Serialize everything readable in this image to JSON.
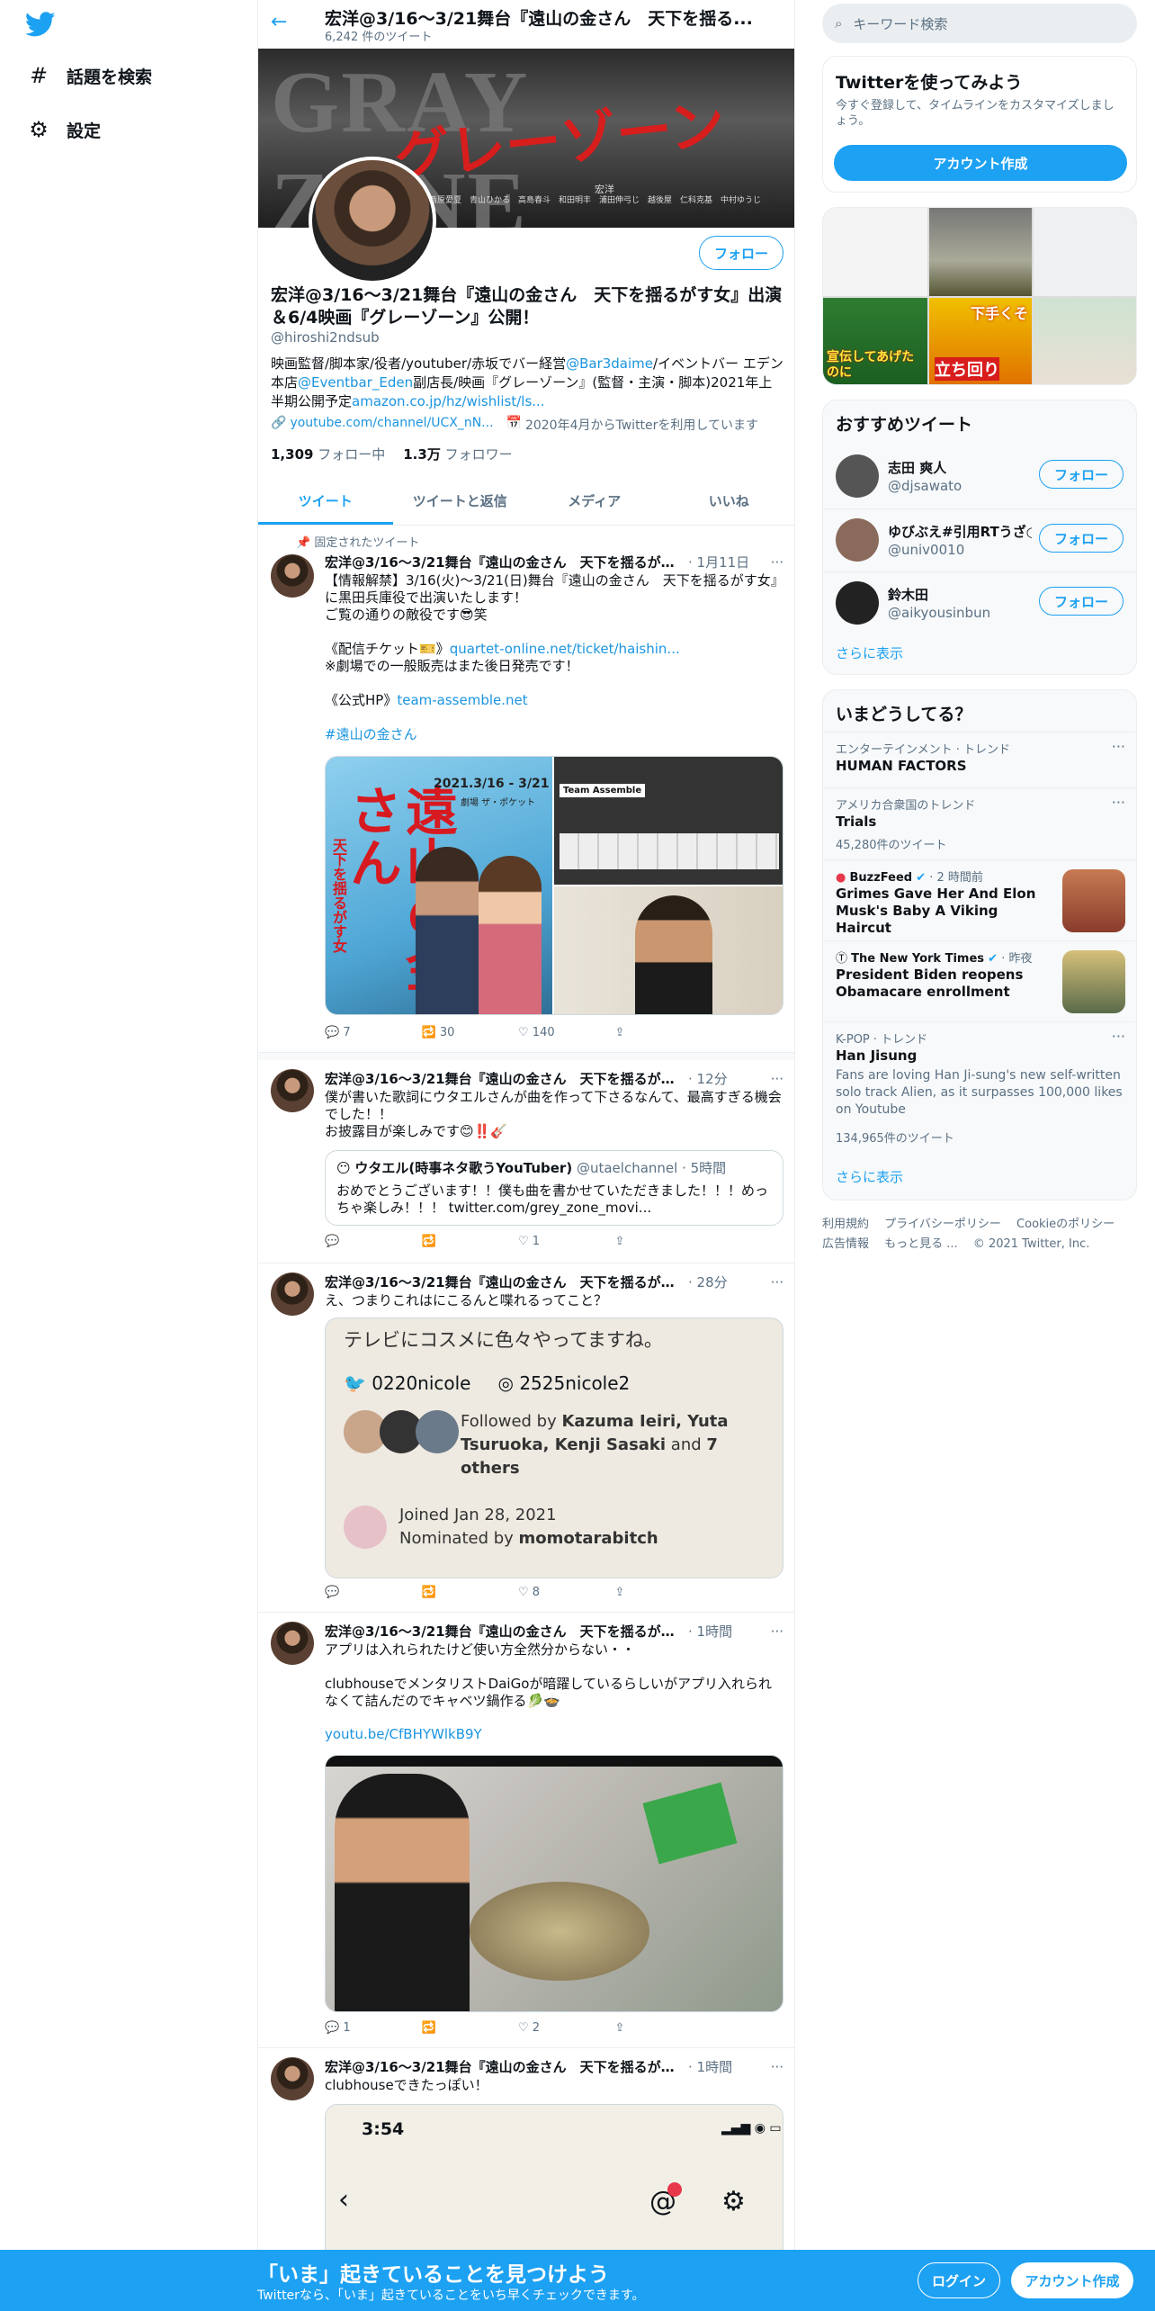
{
  "nav": {
    "explore": "話題を検索",
    "settings": "設定"
  },
  "header": {
    "title": "宏洋@3/16〜3/21舞台『遠山の金さん　天下を揺る...",
    "subtitle": "6,242 件のツイート"
  },
  "banner": {
    "text1": "GRAY ZONE",
    "text2": "グレーゾーン",
    "credit_lead": "宏洋",
    "credits": "西原愛夏　青山ひかる　高島春斗　和田明丰　浦田伸弓じ　越後屋　仁科克基　中村ゆうじ"
  },
  "profile": {
    "follow_label": "フォロー",
    "name": "宏洋@3/16〜3/21舞台『遠山の金さん　天下を揺るがす女』出演＆6/4映画『グレーゾーン』公開！",
    "handle": "@hiroshi2ndsub",
    "bio_1": "映画監督/脚本家/役者/youtuber/赤坂でバー経営",
    "bio_link1": "@Bar3daime",
    "bio_2": "/イベントバー エデン本店",
    "bio_link2": "@Eventbar_Eden",
    "bio_3": "副店長/映画『グレーゾーン』(監督・主演・脚本)2021年上半期公開予定",
    "bio_link3": "amazon.co.jp/hz/wishlist/ls...",
    "link": "youtube.com/channel/UCX_nN...",
    "joined": "2020年4月からTwitterを利用しています",
    "following_count": "1,309",
    "following_label": "フォロー中",
    "followers_count": "1.3万",
    "followers_label": "フォロワー"
  },
  "tabs": [
    "ツイート",
    "ツイートと返信",
    "メディア",
    "いいね"
  ],
  "tweets": [
    {
      "pinned": "固定されたツイート",
      "name": "宏洋@3/16〜3/21舞台『遠山の金さん　天下を揺るがす女...",
      "date": "· 1月11日",
      "text1": "【情報解禁】3/16(火)〜3/21(日)舞台『遠山の金さん　天下を揺るがす女』に黒田兵庫役で出演いたします！\nご覧の通りの敵役です😎笑\n\n《配信チケット🎫》",
      "link1": "quartet-online.net/ticket/haishin...",
      "text2": "※劇場での一般販売はまた後日発売です！\n\n《公式HP》",
      "link2": "team-assemble.net",
      "hashtag": "#遠山の金さん",
      "poster_title": "遠山の金さん",
      "poster_sub": "天下を揺るがす女",
      "poster_date": "2021.3/16 - 3/21",
      "poster_venue": "劇場 ザ・ポケット",
      "poster_team": "Team Assemble",
      "replies": "7",
      "retweets": "30",
      "likes": "140"
    },
    {
      "name": "宏洋@3/16〜3/21舞台『遠山の金さん　天下を揺るがす女』...",
      "date": "· 12分",
      "text": "僕が書いた歌詞にウタエルさんが曲を作って下さるなんて、最高すぎる機会でした！！\nお披露目が楽しみです😊‼️🎸",
      "quote_name": "ウタエル(時事ネタ歌うYouTuber)",
      "quote_handle": "@utaelchannel · 5時間",
      "quote_text": "おめでとうございます！！僕も曲を書かせていただきました！！！めっちゃ楽しみ！！！ twitter.com/grey_zone_movi...",
      "replies": "",
      "retweets": "",
      "likes": "1"
    },
    {
      "name": "宏洋@3/16〜3/21舞台『遠山の金さん　天下を揺るがす女』...",
      "date": "· 28分",
      "text": "え、つまりこれはにこるんと喋れるってこと？",
      "card_line1": "テレビにコスメに色々やってますね。",
      "card_tw": "0220nicole",
      "card_ig": "2525nicole2",
      "card_followed_pre": "Followed by ",
      "card_followed_names": "Kazuma Ieiri, Yuta Tsuruoka, Kenji Sasaki",
      "card_followed_and": " and ",
      "card_followed_others": "7 others",
      "card_joined": "Joined Jan 28, 2021",
      "card_nominated_pre": "Nominated by ",
      "card_nominated_by": "momotarabitch",
      "replies": "",
      "retweets": "",
      "likes": "8"
    },
    {
      "name": "宏洋@3/16〜3/21舞台『遠山の金さん　天下を揺るがす女』...",
      "date": "· 1時間",
      "text": "アプリは入れられたけど使い方全然分からない・・\n\nclubhouseでメンタリストDaiGoが暗躍しているらしいがアプリ入れられなくて詰んだのでキャベツ鍋作る🥬🍲",
      "link": "youtu.be/CfBHYWlkB9Y",
      "replies": "1",
      "retweets": "",
      "likes": "2"
    },
    {
      "name": "宏洋@3/16〜3/21舞台『遠山の金さん　天下を揺るがす女』...",
      "date": "· 1時間",
      "text": "clubhouseできたっぽい！",
      "phone_time": "3:54"
    }
  ],
  "search": {
    "placeholder": "キーワード検索"
  },
  "signup": {
    "title": "Twitterを使ってみよう",
    "desc": "今すぐ登録して、タイムラインをカスタマイズしましょう。",
    "button": "アカウント作成"
  },
  "media_grid": {
    "label_a": "宣伝してあげたのに",
    "label_b": "下手くそ",
    "label_c": "立ち回り"
  },
  "who_to_follow": {
    "title": "おすすめツイート",
    "users": [
      {
        "name": "志田 爽人",
        "handle": "@djsawato"
      },
      {
        "name": "ゆびぶえ#引用RTうざ○",
        "handle": "@univ0010"
      },
      {
        "name": "鈴木田",
        "handle": "@aikyousinbun"
      }
    ],
    "follow_label": "フォロー",
    "more": "さらに表示"
  },
  "trends": {
    "title": "いまどうしてる？",
    "items": [
      {
        "context": "エンターテインメント · トレンド",
        "name": "HUMAN FACTORS",
        "count": ""
      },
      {
        "context": "アメリカ合衆国のトレンド",
        "name": "Trials",
        "count": "45,280件のツイート"
      },
      {
        "context": "BuzzFeed",
        "meta": "· 2 時間前",
        "name": "Grimes Gave Her And Elon Musk's Baby A Viking Haircut"
      },
      {
        "context": "The New York Times",
        "meta": "· 昨夜",
        "name": "President Biden reopens Obamacare enrollment"
      },
      {
        "context": "K-POP · トレンド",
        "name": "Han Jisung",
        "desc": "Fans are loving Han Ji-sung's new self-written solo track Alien, as it surpasses 100,000 likes on Youtube",
        "count": "134,965件のツイート"
      }
    ],
    "more": "さらに表示"
  },
  "footer": {
    "terms": "利用規約",
    "privacy": "プライバシーポリシー",
    "cookie": "Cookieのポリシー",
    "ads": "広告情報",
    "more": "もっと見る ...",
    "copyright": "© 2021 Twitter, Inc."
  },
  "bottom": {
    "title": "「いま」起きていることを見つけよう",
    "sub": "Twitterなら、「いま」起きていることをいち早くチェックできます。",
    "login": "ログイン",
    "signup": "アカウント作成"
  }
}
